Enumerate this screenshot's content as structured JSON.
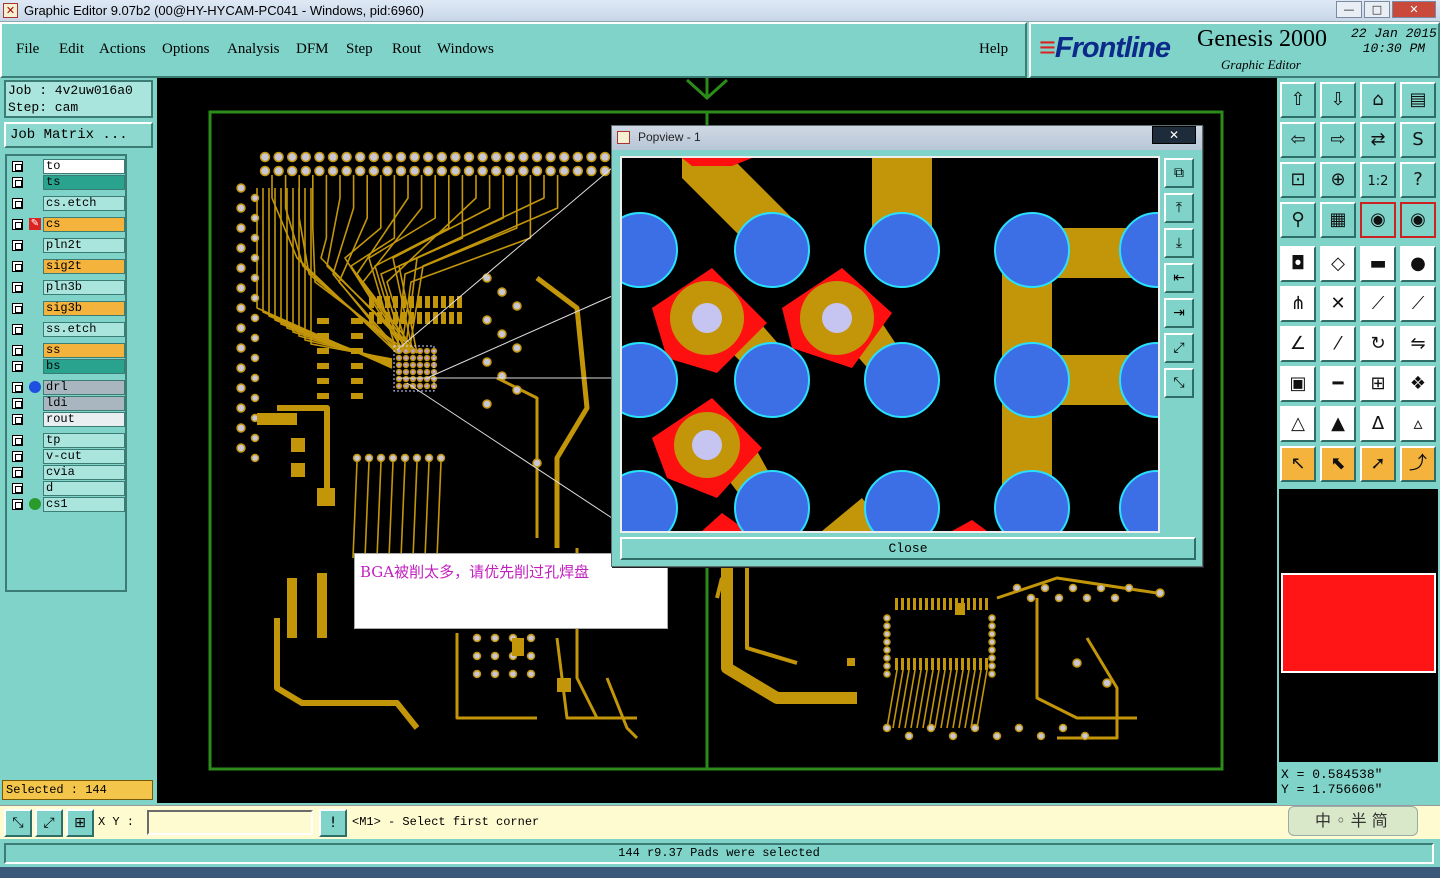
{
  "window": {
    "title": "Graphic Editor 9.07b2 (00@HY-HYCAM-PC041 - Windows, pid:6960)",
    "controls": [
      "—",
      "□",
      "✕"
    ]
  },
  "menu": {
    "items": [
      "File",
      "Edit",
      "Actions",
      "Options",
      "Analysis",
      "DFM",
      "Step",
      "Rout",
      "Windows"
    ],
    "help": "Help"
  },
  "brand": {
    "logo_main": "Frontline",
    "product": "Genesis 2000",
    "subtitle": "Graphic Editor",
    "date": "22 Jan 2015",
    "time": "10:30 PM"
  },
  "job": {
    "job_line": "Job : 4v2uw016a0",
    "step_line": "Step: cam",
    "matrix_button": "Job Matrix ..."
  },
  "layers": [
    {
      "name": "to",
      "color": "#ffffff",
      "tag": ""
    },
    {
      "name": "ts",
      "color": "#2aa38e",
      "tag": ""
    },
    {
      "name": "cs.etch",
      "color": "#a9e4dd",
      "tag": ""
    },
    {
      "name": "cs",
      "color": "#f3b33d",
      "tag": "edit"
    },
    {
      "name": "pln2t",
      "color": "#a9e4dd",
      "tag": ""
    },
    {
      "name": "sig2t",
      "color": "#f3b33d",
      "tag": ""
    },
    {
      "name": "pln3b",
      "color": "#a9e4dd",
      "tag": ""
    },
    {
      "name": "sig3b",
      "color": "#f3b33d",
      "tag": ""
    },
    {
      "name": "ss.etch",
      "color": "#a9e4dd",
      "tag": ""
    },
    {
      "name": "ss",
      "color": "#f3b33d",
      "tag": ""
    },
    {
      "name": "bs",
      "color": "#2aa38e",
      "tag": ""
    },
    {
      "name": "drl",
      "color": "#a9b6c0",
      "tag": "blue-dot"
    },
    {
      "name": "ldi",
      "color": "#a9b6c0",
      "tag": ""
    },
    {
      "name": "rout",
      "color": "#e9eef0",
      "tag": ""
    },
    {
      "name": "tp",
      "color": "#a9e4dd",
      "tag": ""
    },
    {
      "name": "v-cut",
      "color": "#a9e4dd",
      "tag": ""
    },
    {
      "name": "cvia",
      "color": "#a9e4dd",
      "tag": ""
    },
    {
      "name": "d",
      "color": "#a9e4dd",
      "tag": ""
    },
    {
      "name": "cs1",
      "color": "#a9e4dd",
      "tag": "green-dot"
    }
  ],
  "selected_info": "Selected : 144",
  "popup": {
    "title": "Popview - 1",
    "close_x": "✕",
    "close_button": "Close",
    "tools": [
      "⧉",
      "⤒",
      "⤓",
      "⇤",
      "⇥",
      "⤢",
      "⤡"
    ]
  },
  "note": {
    "text": "BGA被削太多，请优先削过孔焊盘"
  },
  "right_tools": [
    [
      "home-up-icon",
      "⇧"
    ],
    [
      "home-down-icon",
      "⇩"
    ],
    [
      "house-icon",
      "⌂"
    ],
    [
      "window-icon",
      "▤"
    ],
    [
      "move-left-icon",
      "⇦"
    ],
    [
      "move-right-icon",
      "⇨"
    ],
    [
      "flip-icon",
      "⇄"
    ],
    [
      "s-icon",
      "S"
    ],
    [
      "fit-icon",
      "⊡"
    ],
    [
      "center-icon",
      "⊕"
    ],
    [
      "scale-icon",
      "1:2"
    ],
    [
      "help-icon",
      "?"
    ],
    [
      "measure-icon",
      "⚲"
    ],
    [
      "grid-icon",
      "▦"
    ],
    [
      "pad-red-icon",
      "◉"
    ],
    [
      "pad-red2-icon",
      "◉"
    ],
    [
      "board-icon",
      "◘"
    ],
    [
      "shape-icon",
      "◇"
    ],
    [
      "ruler-icon",
      "▬"
    ],
    [
      "dot-icon",
      "●"
    ],
    [
      "node-icon",
      "⋔"
    ],
    [
      "cross-icon",
      "✕"
    ],
    [
      "line-add-icon",
      "⟋"
    ],
    [
      "line-cut-icon",
      "⟋"
    ],
    [
      "angle-icon",
      "∠"
    ],
    [
      "slash-icon",
      "⁄"
    ],
    [
      "rotate-icon",
      "↻"
    ],
    [
      "mirror-icon",
      "⇋"
    ],
    [
      "box-select-icon",
      "▣"
    ],
    [
      "bar-icon",
      "━"
    ],
    [
      "fit-box-icon",
      "⊞"
    ],
    [
      "group-icon",
      "❖"
    ],
    [
      "triangle-icon",
      "△"
    ],
    [
      "triangle2-icon",
      "▲"
    ],
    [
      "triangle3-icon",
      "Δ"
    ],
    [
      "triangle4-icon",
      "▵"
    ],
    [
      "pointer-icon",
      "↖"
    ],
    [
      "pointer-box-icon",
      "⬉"
    ],
    [
      "pointer-circle-icon",
      "➚"
    ],
    [
      "pointer-path-icon",
      "⤴"
    ]
  ],
  "coords": {
    "x": "X = 0.584538\"",
    "y": "Y = 1.756606\""
  },
  "command": {
    "xy_label": "X Y :",
    "xy_value": "",
    "prompt": "<M1> - Select first corner",
    "ime_text": "中 ◦ 半 简"
  },
  "status": "144 r9.37 Pads were selected",
  "colors": {
    "panel": "#7fd3c9",
    "copper": "#c3960a",
    "pad": "#3c6ee6",
    "highlight": "#ff1515",
    "frame": "#2b8c1a"
  }
}
